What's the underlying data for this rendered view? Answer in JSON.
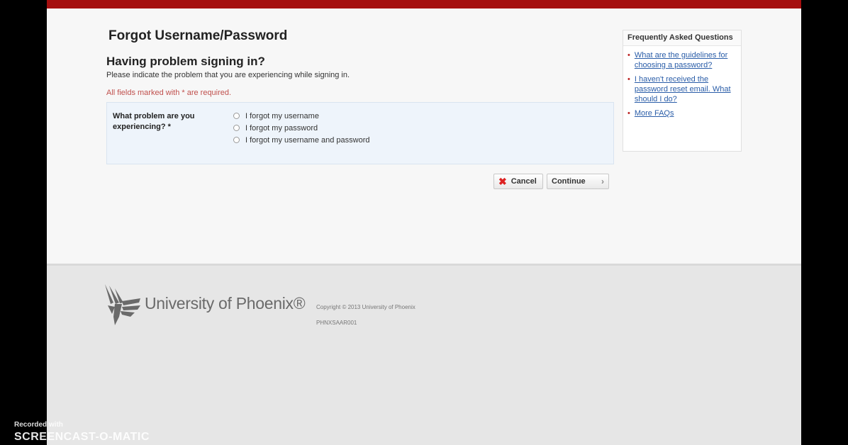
{
  "page": {
    "title": "Forgot Username/Password",
    "subtitle": "Having problem signing in?",
    "instruction": "Please indicate the problem that you are experiencing while signing in.",
    "required_note": "All fields marked with * are required."
  },
  "form": {
    "question_label": "What problem are you experiencing? *",
    "options": [
      {
        "label": "I forgot my username",
        "selected": false
      },
      {
        "label": "I forgot my password",
        "selected": false
      },
      {
        "label": "I forgot my username and password",
        "selected": false
      }
    ],
    "cancel_label": "Cancel",
    "continue_label": "Continue"
  },
  "faq": {
    "header": "Frequently Asked Questions",
    "items": [
      "What are the guidelines for choosing a password?",
      "I haven't received the password reset email. What should I do?",
      "More FAQs"
    ]
  },
  "footer": {
    "brand": "University of Phoenix®",
    "copyright": "Copyright © 2013 University of Phoenix",
    "code": "PHNXSAAR001"
  },
  "watermark": {
    "top": "Recorded with",
    "main": "SCREENCAST-O-MATIC"
  },
  "colors": {
    "header_bar": "#a50f0f",
    "link": "#2a5da8",
    "required": "#c0504d"
  }
}
